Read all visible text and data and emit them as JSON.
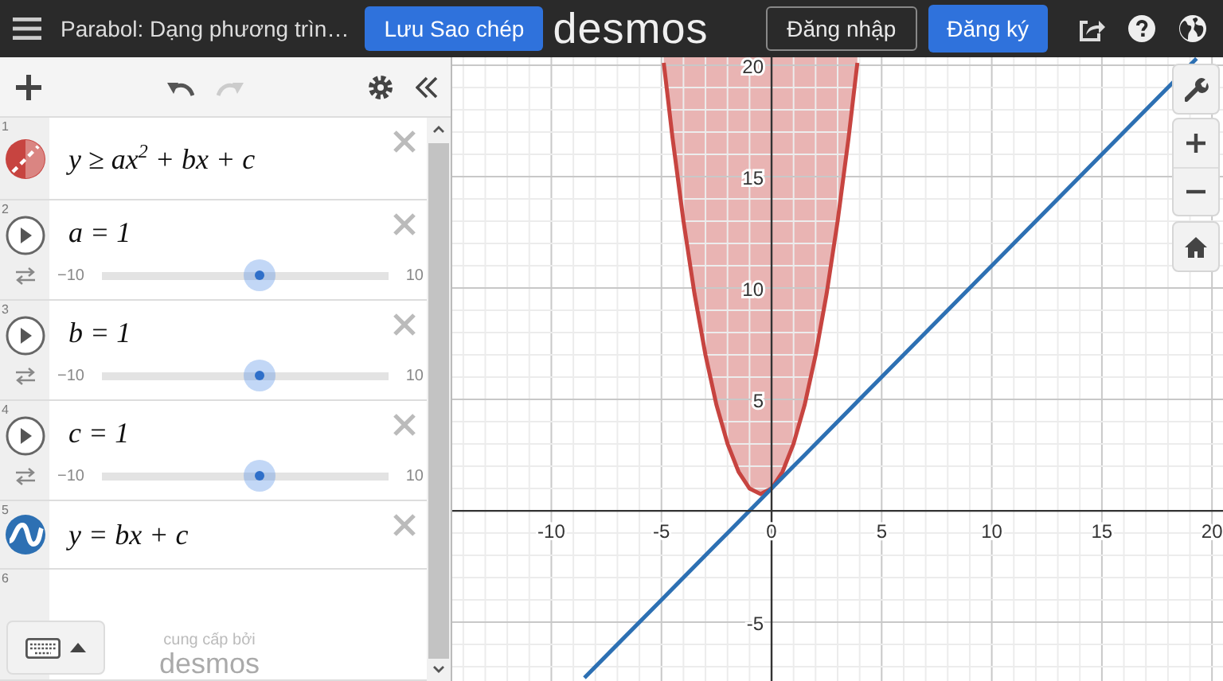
{
  "topbar": {
    "title": "Parabol: Dạng phương trìn…",
    "save_button": "Lưu Sao chép",
    "logo": "desmos",
    "login_button": "Đăng nhập",
    "signup_button": "Đăng ký"
  },
  "expressions": [
    {
      "number": "1",
      "kind": "inequality",
      "color": "#c74440",
      "text": "y ≥ ax$^{2}$ + bx + c"
    },
    {
      "number": "2",
      "kind": "slider",
      "text": "a = 1",
      "min": "−10",
      "max": "10",
      "level": 0.55
    },
    {
      "number": "3",
      "kind": "slider",
      "text": "b = 1",
      "min": "−10",
      "max": "10",
      "level": 0.55
    },
    {
      "number": "4",
      "kind": "slider",
      "text": "c = 1",
      "min": "−10",
      "max": "10",
      "level": 0.55
    },
    {
      "number": "5",
      "kind": "function",
      "color": "#2d70b3",
      "text": "y = bx + c"
    },
    {
      "number": "6",
      "kind": "empty"
    }
  ],
  "footer": {
    "powered_by": "cung cấp bởi",
    "logo": "desmos"
  },
  "graph": {
    "chart_data": {
      "type": "line",
      "grid": true,
      "xlim": [
        -14.5,
        20.5
      ],
      "ylim": [
        -7.64,
        20.36
      ],
      "xticks": [
        -10,
        -5,
        0,
        5,
        10,
        15,
        20
      ],
      "yticks": [
        -5,
        5,
        10,
        15,
        20
      ],
      "x": [
        -8.5,
        -4.9,
        -4.5,
        -4,
        -3.5,
        -3,
        -2.5,
        -2,
        -1.5,
        -1,
        -0.5,
        0,
        0.5,
        1,
        1.5,
        2,
        2.5,
        3,
        3.5,
        3.9,
        19.3
      ],
      "series": [
        {
          "color": "#c74440",
          "values": [
            null,
            20.11,
            16.75,
            13,
            9.75,
            7,
            4.75,
            3,
            1.75,
            1,
            0.75,
            1,
            1.75,
            3,
            4.75,
            7,
            9.75,
            13,
            16.75,
            20.11,
            null
          ]
        },
        {
          "color": "#2d70b3",
          "values": [
            -7.5,
            -3.9,
            -3.5,
            -3,
            -2.5,
            -2,
            -1.5,
            -1,
            -0.5,
            0,
            0.5,
            1,
            1.5,
            2,
            2.5,
            3,
            3.5,
            4,
            4.5,
            4.9,
            20.3
          ]
        }
      ]
    }
  }
}
